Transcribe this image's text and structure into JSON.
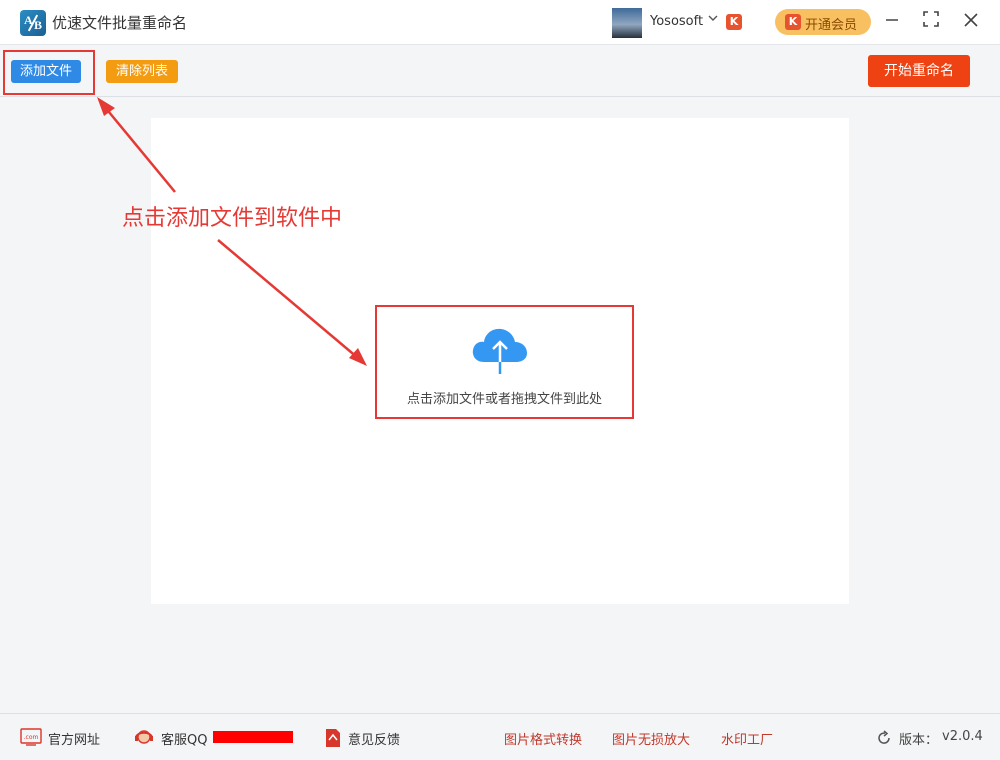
{
  "app": {
    "title": "优速文件批量重命名",
    "logo_letters": "AB"
  },
  "user": {
    "name": "Yososoft",
    "badge": "K"
  },
  "vip": {
    "label": "开通会员",
    "icon": "K"
  },
  "window_controls": {
    "minimize": "—",
    "maximize": "⛶",
    "close": "✕"
  },
  "toolbar": {
    "add_label": "添加文件",
    "clear_label": "清除列表",
    "start_label": "开始重命名"
  },
  "main": {
    "drop_hint": "点击添加文件或者拖拽文件到此处"
  },
  "annotation": {
    "text": "点击添加文件到软件中",
    "color": "#e53935"
  },
  "footer": {
    "website": "官方网址",
    "service_qq": "客服QQ",
    "feedback": "意见反馈",
    "links": [
      "图片格式转换",
      "图片无损放大",
      "水印工厂"
    ],
    "version_label": "版本：",
    "version": "v2.0.4",
    "website_icon_text": ".com"
  },
  "colors": {
    "add_button": "#2f8ae6",
    "clear_button": "#f39c12",
    "start_button": "#ee4213",
    "vip": "#f9c062",
    "cloud": "#3498f3",
    "link": "#c0392b"
  }
}
